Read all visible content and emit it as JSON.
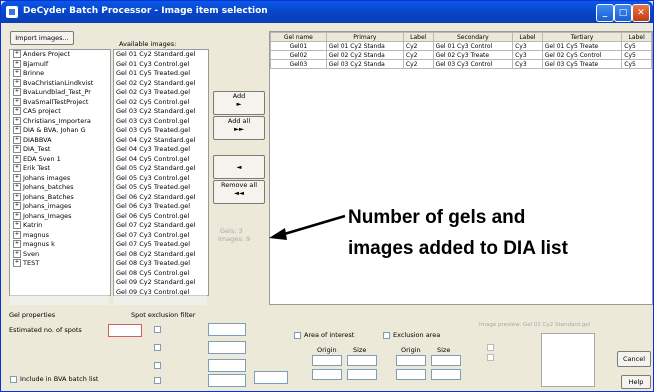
{
  "window": {
    "title": "DeCyder Batch Processor - Image item selection"
  },
  "left": {
    "import_button": "Import images...",
    "available_label": "Available images:",
    "projects": [
      "Anders Project",
      "Bjarnulf",
      "Brinne",
      "BvaChristianLindkvist",
      "BvaLundblad_Test_Pr",
      "BvaSmallTestProject",
      "CAS project",
      "Christians_Importera",
      "DIA & BVA, Johan G",
      "DIABBVA",
      "DIA_Test",
      "EDA Sven 1",
      "Erik Test",
      "Johans images",
      "Johans_batches",
      "Johans_Batches",
      "Johans_images",
      "Johans_Images",
      "Katrin",
      "magnus",
      "magnus k",
      "Sven",
      "TEST"
    ],
    "images": [
      "Gel 01 Cy2 Standard.gel",
      "Gel 01 Cy3 Control.gel",
      "Gel 01 Cy5 Treated.gel",
      "Gel 02 Cy2 Standard.gel",
      "Gel 02 Cy3 Treated.gel",
      "Gel 02 Cy5 Control.gel",
      "Gel 03 Cy2 Standard.gel",
      "Gel 03 Cy3 Control.gel",
      "Gel 03 Cy5 Treated.gel",
      "Gel 04 Cy2 Standard.gel",
      "Gel 04 Cy3 Treated.gel",
      "Gel 04 Cy5 Control.gel",
      "Gel 05 Cy2 Standard.gel",
      "Gel 05 Cy3 Control.gel",
      "Gel 05 Cy5 Treated.gel",
      "Gel 06 Cy2 Standard.gel",
      "Gel 06 Cy3 Treated.gel",
      "Gel 06 Cy5 Control.gel",
      "Gel 07 Cy2 Standard.gel",
      "Gel 07 Cy3 Control.gel",
      "Gel 07 Cy5 Treated.gel",
      "Gel 08 Cy2 Standard.gel",
      "Gel 08 Cy3 Treated.gel",
      "Gel 08 Cy5 Control.gel",
      "Gel 09 Cy2 Standard.gel",
      "Gel 09 Cy3 Control.gel"
    ]
  },
  "middle": {
    "add": "Add",
    "add_all": "Add all",
    "remove": "◄",
    "remove_all": "Remove all",
    "gels_label": "Gels:",
    "gels_value": "3",
    "images_label": "Images:",
    "images_value": "9"
  },
  "table": {
    "headers": [
      "Gel name",
      "Primary",
      "Label",
      "Secondary",
      "Label",
      "Tertiary",
      "Label"
    ],
    "rows": [
      [
        "Gel01",
        "Gel 01 Cy2 Standa",
        "Cy2",
        "Gel 01 Cy3 Control",
        "Cy3",
        "Gel 01 Cy5 Treate",
        "Cy5"
      ],
      [
        "Gel02",
        "Gel 02 Cy2 Standa",
        "Cy2",
        "Gel 02 Cy3 Treate",
        "Cy3",
        "Gel 02 Cy5 Control",
        "Cy5"
      ],
      [
        "Gel03",
        "Gel 03 Cy2 Standa",
        "Cy2",
        "Gel 03 Cy3 Control",
        "Cy3",
        "Gel 03 Cy5 Treate",
        "Cy5"
      ]
    ]
  },
  "annotation": {
    "line1": "Number of gels and",
    "line2": "images added to DIA list"
  },
  "bottom": {
    "gel_properties": "Gel properties",
    "est_spots": "Estimated no. of spots",
    "include_bva": "Include in BVA batch list",
    "spot_filter": "Spot exclusion filter",
    "area_interest": "Area of interest",
    "exclusion_area": "Exclusion area",
    "origin": "Origin",
    "size": "Size",
    "preview_label": "Image preview: Gel 01 Cy2 Standard.gel",
    "cancel": "Cancel",
    "help": "Help"
  }
}
